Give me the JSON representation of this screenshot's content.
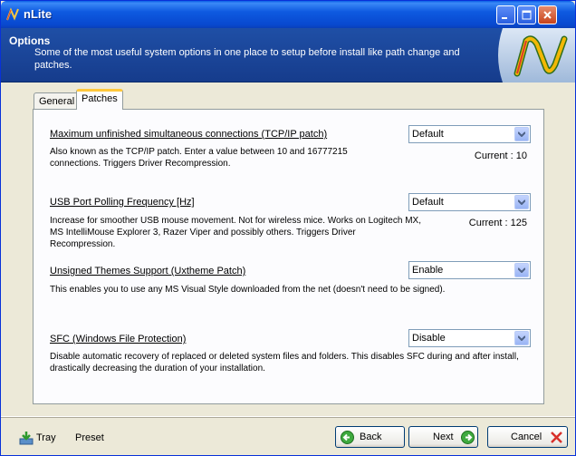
{
  "window": {
    "title": "nLite"
  },
  "header": {
    "title": "Options",
    "description": "Some of the most useful system options in one place to setup before install like path change and patches."
  },
  "tabs": [
    {
      "label": "General",
      "selected": false
    },
    {
      "label": "Patches",
      "selected": true
    }
  ],
  "options": [
    {
      "title": "Maximum unfinished simultaneous connections (TCP/IP patch)",
      "description": "Also known as the TCP/IP patch. Enter a value between 10 and 16777215 connections. Triggers Driver Recompression.",
      "value": "Default",
      "current": "Current : 10"
    },
    {
      "title": "USB Port Polling Frequency [Hz]",
      "description": "Increase for smoother USB mouse movement. Not for wireless mice. Works on Logitech MX, MS IntelliMouse Explorer 3, Razer Viper and possibly others. Triggers Driver Recompression.",
      "value": "Default",
      "current": "Current : 125"
    },
    {
      "title": "Unsigned Themes Support (Uxtheme Patch)",
      "description": "This enables you to use any MS Visual Style downloaded from the net (doesn't need to be signed).",
      "value": "Enable",
      "current": ""
    },
    {
      "title": "SFC (Windows File Protection)",
      "description": "Disable automatic recovery of replaced or deleted system files and folders. This disables SFC during and after install, drastically decreasing the duration of your installation.",
      "value": "Disable",
      "current": ""
    }
  ],
  "footer": {
    "tray_label": "Tray",
    "preset_label": "Preset",
    "back_label": "Back",
    "next_label": "Next",
    "cancel_label": "Cancel"
  },
  "colors": {
    "titlebar": "#0A5FE6",
    "header": "#1F4FA6",
    "face": "#ECE9D8",
    "tab_highlight": "#FFC83C"
  }
}
